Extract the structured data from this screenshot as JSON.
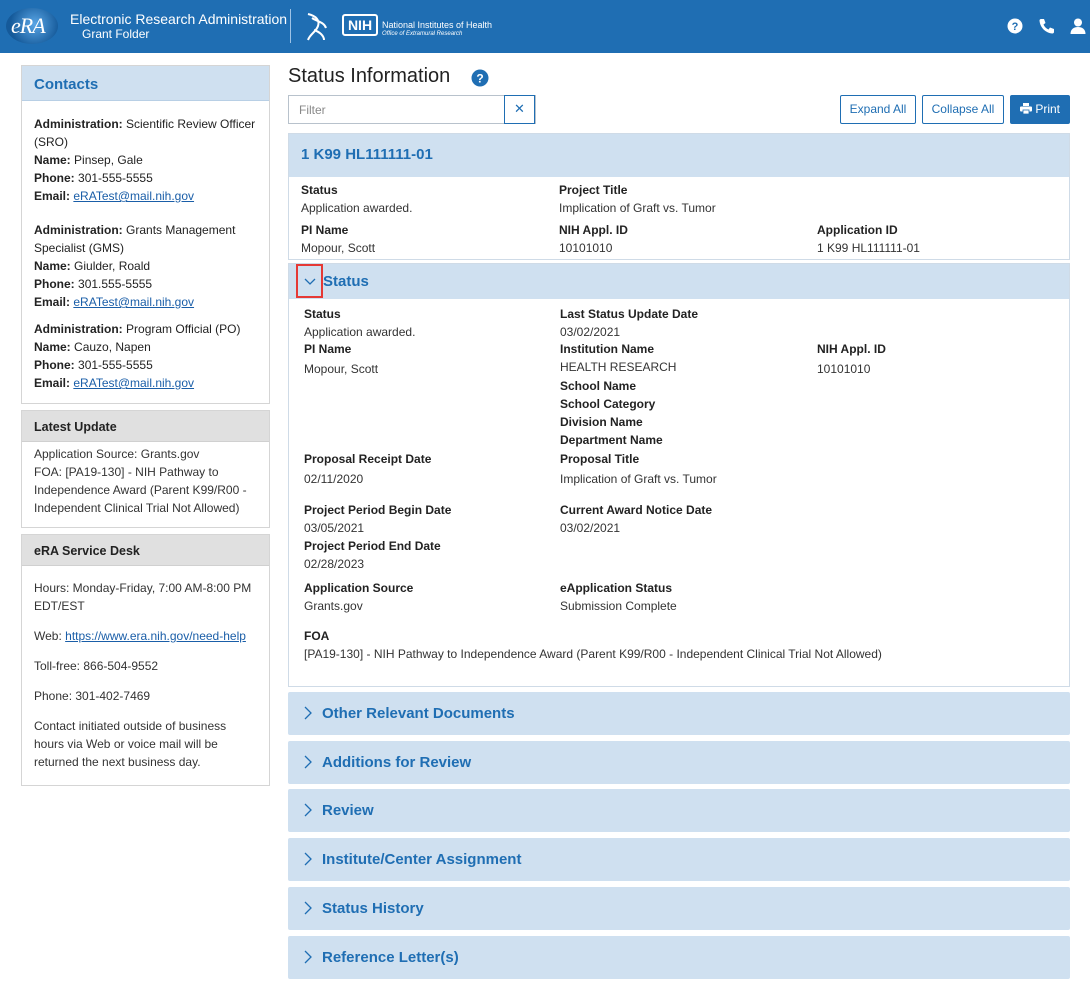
{
  "header": {
    "logo_text": "eRA",
    "app_title": "Electronic Research Administration",
    "app_subtitle": "Grant Folder",
    "nih_logo": "NIH",
    "nih_name": "National Institutes of Health",
    "nih_office": "Office of Extramural Research",
    "icons": [
      "question-circle-icon",
      "phone-icon",
      "user-icon"
    ],
    "brand_color": "#1f6eb3"
  },
  "contacts": {
    "title": "Contacts",
    "entries": [
      {
        "admin_label": "Administration:",
        "admin": "Scientific Review Officer (SRO)",
        "name_label": "Name:",
        "name": "Pinsep, Gale",
        "phone_label": "Phone:",
        "phone": "301-555-5555",
        "email_label": "Email:",
        "email": "eRATest@mail.nih.gov"
      },
      {
        "admin_label": "Administration:",
        "admin": "Grants Management Specialist (GMS)",
        "name_label": "Name:",
        "name": "Giulder, Roald",
        "phone_label": "Phone:",
        "phone": "301.555-5555",
        "email_label": "Email:",
        "email": "eRATest@mail.nih.gov"
      },
      {
        "admin_label": "Administration:",
        "admin": "Program Official (PO)",
        "name_label": "Name:",
        "name": "Cauzo, Napen",
        "phone_label": "Phone:",
        "phone": "301-555-5555",
        "email_label": "Email:",
        "email": "eRATest@mail.nih.gov"
      }
    ]
  },
  "latest_update": {
    "title": "Latest Update",
    "source": "Application Source: Grants.gov",
    "foa": "FOA: [PA19-130] -  NIH Pathway to Independence Award (Parent K99/R00 - Independent Clinical Trial Not Allowed)"
  },
  "service_desk": {
    "title": "eRA Service Desk",
    "hours": "Hours: Monday-Friday, 7:00 AM-8:00 PM EDT/EST",
    "web_label": "Web:",
    "web_link": "https://www.era.nih.gov/need-help",
    "tollfree": "Toll-free: 866-504-9552",
    "phone": "Phone: 301-402-7469",
    "note": "Contact initiated outside of business hours via Web or voice mail will be returned the next business day."
  },
  "main": {
    "title": "Status Information",
    "filter_placeholder": "Filter",
    "clear_symbol": "✕",
    "expand_all": "Expand All",
    "collapse_all": "Collapse All",
    "print": "Print"
  },
  "grant": {
    "id": "1 K99 HL111111-01",
    "status_label": "Status",
    "status": "Application awarded.",
    "title_label": "Project Title",
    "title": "Implication of Graft vs. Tumor",
    "pi_label": "PI Name",
    "pi": "Mopour,  Scott",
    "appl_id_label": "NIH Appl. ID",
    "appl_id": "10101010",
    "application_id_label": "Application ID",
    "application_id": "1 K99 HL111111-01"
  },
  "status_section": {
    "title": "Status",
    "status_label": "Status",
    "status": "Application awarded.",
    "last_update_label": "Last Status Update Date",
    "last_update": "03/02/2021",
    "pi_label": "PI Name",
    "pi": "Mopour,  Scott",
    "institution_label": "Institution Name",
    "institution": "HEALTH RESEARCH",
    "appl_id_label": "NIH Appl. ID",
    "appl_id": "10101010",
    "school_name_label": "School Name",
    "school_category_label": "School Category",
    "division_label": "Division Name",
    "department_label": "Department Name",
    "receipt_label": "Proposal Receipt Date",
    "receipt": "02/11/2020",
    "proposal_title_label": "Proposal Title",
    "proposal_title": "Implication of Graft vs. Tumor",
    "begin_label": "Project Period Begin Date",
    "begin": "03/05/2021",
    "award_notice_label": "Current Award Notice Date",
    "award_notice": "03/02/2021",
    "end_label": "Project Period End Date",
    "end": "02/28/2023",
    "app_source_label": "Application Source",
    "app_source": "Grants.gov",
    "eapp_status_label": "eApplication Status",
    "eapp_status": "Submission Complete",
    "foa_label": "FOA",
    "foa": "[PA19-130] -  NIH Pathway to Independence Award (Parent K99/R00 - Independent Clinical Trial Not Allowed)"
  },
  "accordions": [
    "Other Relevant Documents",
    "Additions for Review",
    "Review",
    "Institute/Center Assignment",
    "Status History",
    "Reference Letter(s)"
  ]
}
